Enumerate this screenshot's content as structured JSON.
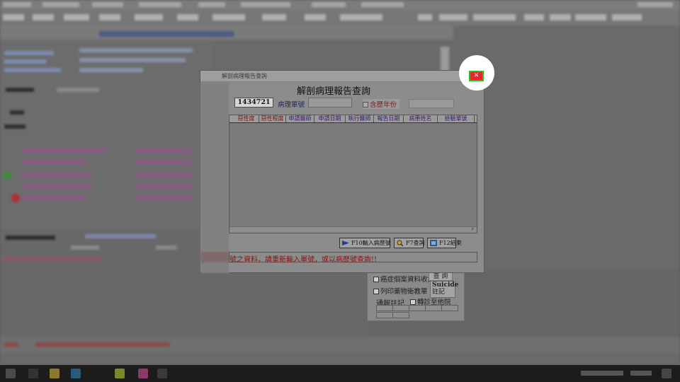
{
  "dialog": {
    "window_title": "解剖病理報告查詢",
    "heading": "解剖病理報告查詢",
    "chart_number": "1434721",
    "pathology_no_label": "病理單號",
    "pathology_no_value": "",
    "include_prev_label": "含歷年份",
    "columns": [
      "惡性度",
      "惡性程度",
      "申請醫師",
      "申請日期",
      "執行醫師",
      "報告日期",
      "病患姓名",
      "檢驗單號"
    ],
    "column_colors": [
      "#7a1010",
      "#7a1010",
      "#3a1a6a",
      "#3a1a6a",
      "#3a1a6a",
      "#3a1a6a",
      "#3a1a6a",
      "#3a1a6a"
    ],
    "buttons": {
      "input_chart": "F10輸入病歷號",
      "query": "F7查詢",
      "exit": "F12結束"
    },
    "message": "號之資料，請重新輸入單號，或以病歷號查詢!!",
    "close_symbol": "✕"
  },
  "lower_panel": {
    "cancer_checkbox": "癌症個案資料收集",
    "query_button": "查 詢",
    "print_checkbox": "列印藥物衛教單",
    "suicide_line1": "Suicide",
    "suicide_line2": "註記",
    "notify_label": "通報註記",
    "referral_checkbox": "轉診至他院"
  },
  "colors": {
    "close_button": "#e8262a",
    "highlight_border": "#22c02c",
    "message_text": "#8c1010"
  }
}
